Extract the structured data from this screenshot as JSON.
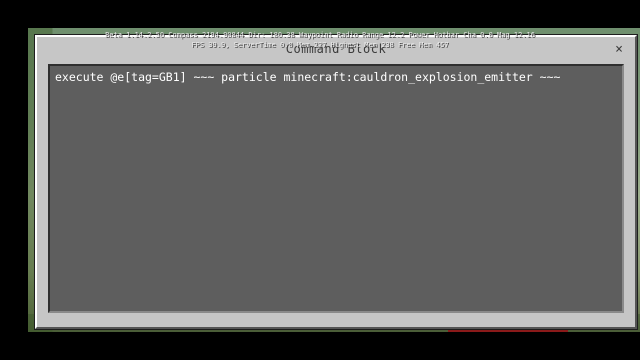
{
  "debug_overlay": {
    "line1": "Beta 1.14.2.50 Compass 2194.90844 Dir: 180.38 Waypoint Radio Range 12.2 Power Hotbar Cha 0.0 Mag 12.16",
    "line2": "FPS 39.9, ServerTime 0.0 Mem 227 Highest Mem 238 Free Mem 457"
  },
  "dialog": {
    "title": "Command Block",
    "close_icon": "×",
    "command_text": "execute @e[tag=GB1] ~~~ particle minecraft:cauldron_explosion_emitter ~~~"
  },
  "colors": {
    "dialog_bg": "#c6c6c6",
    "input_bg": "#5e5e5e",
    "text": "#ffffff"
  }
}
